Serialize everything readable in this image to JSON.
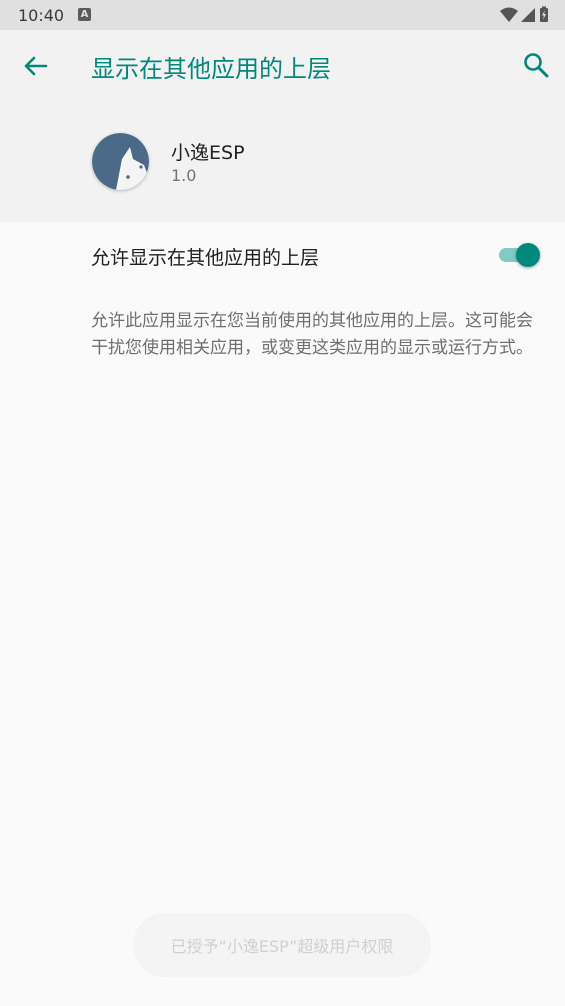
{
  "status_bar": {
    "time": "10:40",
    "notification_badge": "A",
    "icons": [
      "wifi-icon",
      "signal-icon",
      "battery-charging-icon"
    ]
  },
  "app_bar": {
    "title": "显示在其他应用的上层",
    "back_icon": "arrow-left-icon",
    "search_icon": "search-icon"
  },
  "app_info": {
    "name": "小逸ESP",
    "version": "1.0"
  },
  "permission": {
    "label": "允许显示在其他应用的上层",
    "enabled": true,
    "description": "允许此应用显示在您当前使用的其他应用的上层。这可能会干扰您使用相关应用，或变更这类应用的显示或运行方式。"
  },
  "toast": {
    "text": "已授予“小逸ESP”超级用户权限"
  },
  "colors": {
    "accent": "#00897b",
    "switch_track": "#80cbc4",
    "status_bar": "#e0e0e0",
    "header_bg": "#f2f2f2",
    "page_bg": "#fafafa",
    "app_icon": "#4a6a88"
  }
}
